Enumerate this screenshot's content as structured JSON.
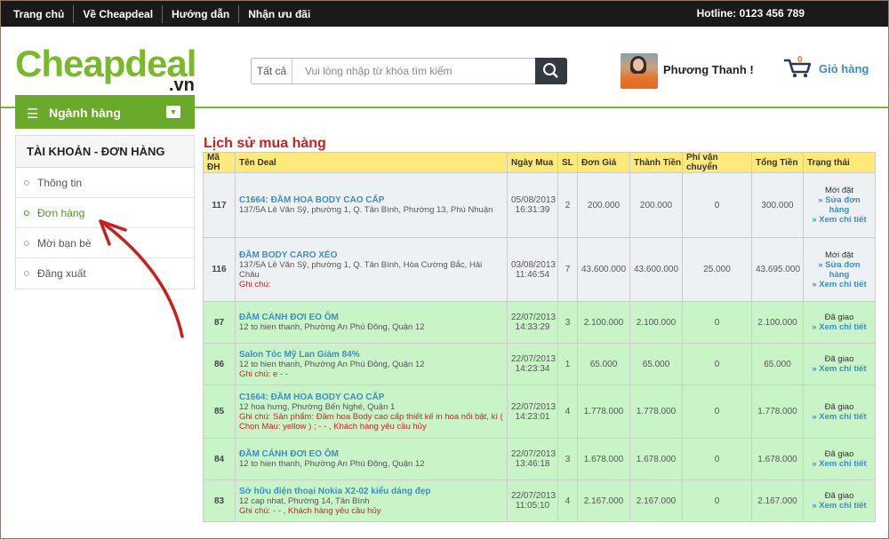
{
  "topbar": {
    "nav": [
      "Trang chủ",
      "Về Cheapdeal",
      "Hướng dẫn",
      "Nhận ưu đãi"
    ],
    "hotline": "Hotline: 0123 456 789"
  },
  "logo": {
    "main": "Cheapdeal",
    "suffix": ".vn"
  },
  "search": {
    "category": "Tất cả",
    "placeholder": "Vui lòng nhập từ khóa tìm kiếm"
  },
  "user": {
    "name": "Phương Thanh !"
  },
  "cart": {
    "count": "0",
    "label": "Giỏ hàng"
  },
  "category_menu": {
    "label": "Ngành hàng"
  },
  "sidebar": {
    "heading": "TÀI KHOẢN - ĐƠN HÀNG",
    "items": [
      {
        "label": "Thông tin",
        "active": false
      },
      {
        "label": "Đơn hàng",
        "active": true
      },
      {
        "label": "Mời bạn bè",
        "active": false
      },
      {
        "label": "Đăng xuất",
        "active": false
      }
    ]
  },
  "colors": {
    "brand_green": "#7ab929",
    "title_red": "#c81f1f",
    "link_blue": "#3a8fc6",
    "header_yellow": "#ffe97a",
    "delivered_row": "#c8f4c8",
    "new_row": "#eef1f4"
  },
  "orders": {
    "title": "Lịch sử mua hàng",
    "columns": [
      "Mã ĐH",
      "Tên Deal",
      "Ngày Mua",
      "SL",
      "Đơn Giá",
      "Thành Tiền",
      "Phí vận chuyển",
      "Tổng Tiền",
      "Trạng thái"
    ],
    "rows": [
      {
        "id": "117",
        "deal": "C1664: ĐẦM HOA BODY CAO CẤP",
        "address": "137/5A Lê Văn Sỹ, phường 1, Q. Tân Bình, Phường 13, Phú Nhuận",
        "note": "",
        "date": "05/08/2013",
        "time": "16:31:39",
        "qty": "2",
        "price": "200.000",
        "subtotal": "200.000",
        "shipping": "0",
        "total": "300.000",
        "status": "Mới đặt",
        "actions": [
          "» Sửa đơn hàng",
          "» Xem chi tiết"
        ],
        "state": "new"
      },
      {
        "id": "116",
        "deal": "ĐẦM BODY CARO XÉO",
        "address": "137/5A Lê Văn Sỹ, phường 1, Q. Tân Bình, Hòa Cường Bắc, Hải Châu",
        "note": "Ghi chú:",
        "date": "03/08/2013",
        "time": "11:46:54",
        "qty": "7",
        "price": "43.600.000",
        "subtotal": "43.600.000",
        "shipping": "25.000",
        "total": "43.695.000",
        "status": "Mới đặt",
        "actions": [
          "» Sửa đơn hàng",
          "» Xem chi tiết"
        ],
        "state": "new"
      },
      {
        "id": "87",
        "deal": "ĐẦM CÁNH ĐƠI EO ÔM",
        "address": "12 to hien thanh, Phường An Phú Đông, Quận 12",
        "note": "",
        "date": "22/07/2013",
        "time": "14:33:29",
        "qty": "3",
        "price": "2.100.000",
        "subtotal": "2.100.000",
        "shipping": "0",
        "total": "2.100.000",
        "status": "Đã giao",
        "actions": [
          "» Xem chi tiết"
        ],
        "state": "done"
      },
      {
        "id": "86",
        "deal": "Salon Tóc Mỹ Lan Giảm 84%",
        "address": "12 to hien thanh, Phường An Phú Đông, Quận 12",
        "note": "Ghi chú: e - -",
        "date": "22/07/2013",
        "time": "14:23:34",
        "qty": "1",
        "price": "65.000",
        "subtotal": "65.000",
        "shipping": "0",
        "total": "65.000",
        "status": "Đã giao",
        "actions": [
          "» Xem chi tiết"
        ],
        "state": "done"
      },
      {
        "id": "85",
        "deal": "C1664: ĐẦM HOA BODY CAO CẤP",
        "address": "12 hoa hưng, Phường Bến Nghé, Quận 1",
        "note": "Ghi chú: Sản phẩm: Đầm hoa Body cao cấp thiết kế in hoa nổi bật, kì ( Chọn Màu: yellow ) ; - - , Khách hàng yêu cầu hủy",
        "date": "22/07/2013",
        "time": "14:23:01",
        "qty": "4",
        "price": "1.778.000",
        "subtotal": "1.778.000",
        "shipping": "0",
        "total": "1.778.000",
        "status": "Đã giao",
        "actions": [
          "» Xem chi tiết"
        ],
        "state": "done"
      },
      {
        "id": "84",
        "deal": "ĐẦM CÁNH ĐƠI EO ÔM",
        "address": "12 to hien thanh, Phường An Phú Đông, Quận 12",
        "note": "",
        "date": "22/07/2013",
        "time": "13:46:18",
        "qty": "3",
        "price": "1.678.000",
        "subtotal": "1.678.000",
        "shipping": "0",
        "total": "1.678.000",
        "status": "Đã giao",
        "actions": [
          "» Xem chi tiết"
        ],
        "state": "done"
      },
      {
        "id": "83",
        "deal": "Sở hữu điện thoại Nokia X2-02 kiểu dáng đẹp",
        "address": "12 cap nhat, Phường 14, Tân Bình",
        "note": "Ghi chú: - - , Khách hàng yêu cầu hủy",
        "date": "22/07/2013",
        "time": "11:05:10",
        "qty": "4",
        "price": "2.167.000",
        "subtotal": "2.167.000",
        "shipping": "0",
        "total": "2.167.000",
        "status": "Đã giao",
        "actions": [
          "» Xem chi tiết"
        ],
        "state": "done"
      }
    ]
  }
}
